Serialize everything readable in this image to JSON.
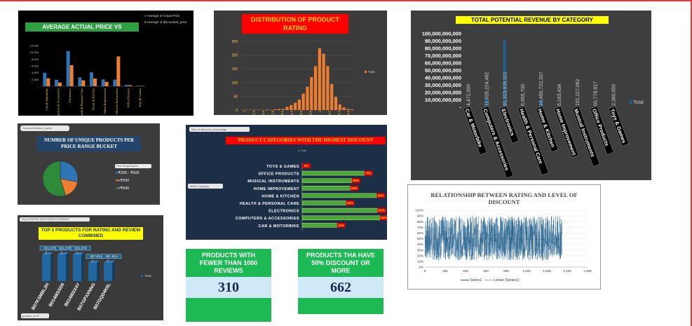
{
  "charts": {
    "avg_price": {
      "title": "AVERAGE ACTUAL PRICE VS",
      "legend": [
        "Average of Actual Price",
        "Average of discounted_price"
      ],
      "colors": {
        "actual": "#2e75b6",
        "discounted": "#ed7d31"
      },
      "yticks": [
        "12,000",
        "10,000",
        "8,000",
        "6,000",
        "4,000",
        "2,000",
        "-"
      ],
      "categories": [
        "Car & Motorbike",
        "Computers & Accessories",
        "Electronics",
        "Health & Personal Care",
        "Home & Kitchen",
        "Home Improvement",
        "Musical Instruments",
        "OfficeProducts",
        "Toys & Games"
      ]
    },
    "rating_dist": {
      "title": "DISTRIBUTION OF PRODUCT RATING",
      "legend": "Total",
      "yticks": [
        "250",
        "200",
        "150",
        "100",
        "50",
        "0"
      ]
    },
    "revenue": {
      "title": "TOTAL POTENTIAL REVENUE BY CATEGORY",
      "legend": "Total",
      "yticks": [
        "100,000,000,000",
        "90,000,000,000",
        "80,000,000,000",
        "70,000,000,000",
        "60,000,000,000",
        "50,000,000,000",
        "40,000,000,000",
        "30,000,000,000",
        "20,000,000,000",
        "10,000,000,000",
        "-"
      ],
      "values": [
        "4,472,000",
        "11,628,224,482",
        "91,323,918,321",
        "6,959,700",
        "10,459,722,337",
        "6,163,434",
        "151,117,062",
        "60,778,817",
        "2,380,050"
      ],
      "categories": [
        "Car & Motorbike",
        "Computers & Accessories",
        "Electronics",
        "Health & Personal Care",
        "Home & Kitchen",
        "Home Improvement",
        "Musical Instruments",
        "Office Products",
        "Toys & Games"
      ]
    },
    "price_bucket": {
      "filter": "Count of product_name",
      "title": "NUMBER OF UNIQUE PRODUCTS PER PRICE RANGE BUCKET",
      "legend_title": "Price Range Bucket",
      "legend": [
        "₹200 - ₹500",
        "<₹200",
        ">₹500"
      ]
    },
    "discount": {
      "filter": "Max of discount_percentage",
      "title": "PRODUCT CATEGORIES WITH THE HIGHEST DISCOUNT",
      "legend": "Total",
      "slicer": "MAIN Category",
      "categories": [
        "TOYS & GAMES",
        "OFFICE PRODUCTS",
        "MUSICAL INSTRUMENTS",
        "HOME IMPROVEMENT",
        "HOME & KITCHEN",
        "HEALTH & PERSONAL CARE",
        "ELECTRONICS",
        "COMPUTERS & ACCESSORIES",
        "CAR & MOTORBIKE"
      ],
      "labels": [
        "0%",
        "75%",
        "60%",
        "58%",
        "90%",
        "53%",
        "91%",
        "94%",
        "42%"
      ]
    },
    "top5": {
      "filter": "Sum of RATING AND REVIEW COMBINED",
      "title": "TOP 5 PRODUCTS FOR RATING AND REVIEW COMBINED",
      "legend": "Total",
      "slicer": "product_id",
      "labels": [
        "531,376",
        "531,376",
        "531,376",
        "367,613",
        "367,613"
      ],
      "categories": [
        "B07KSMBL2H",
        "B014I8SSD0",
        "B014I8SX4Y",
        "B07GPXXNNG",
        "B07GQD4K6L"
      ]
    },
    "scatter": {
      "title": "RELATIONSHIP BETWEEN RATING AND LEVEL OF DISCOUNT",
      "yticks": [
        "100%",
        "90%",
        "80%",
        "70%",
        "60%",
        "50%",
        "40%",
        "30%",
        "20%",
        "10%",
        "0%"
      ],
      "xticks": [
        "0",
        "200",
        "400",
        "600",
        "800",
        "1,000",
        "1,200",
        "1,400",
        "1,600"
      ],
      "legend": [
        "Series1",
        "Linear (Series1)"
      ]
    }
  },
  "chart_data": [
    {
      "type": "bar",
      "categories": [
        "Car & Motorbike",
        "Computers & Accessories",
        "Electronics",
        "Health & Personal Care",
        "Home & Kitchen",
        "Home Improvement",
        "Musical Instruments",
        "OfficeProducts",
        "Toys & Games"
      ],
      "ylim": [
        0,
        12000
      ],
      "series": [
        {
          "name": "Average of Actual Price",
          "values": [
            4000,
            1900,
            10400,
            2600,
            4100,
            2000,
            1950,
            400,
            150
          ]
        },
        {
          "name": "Average of discounted_price",
          "values": [
            2350,
            1100,
            6200,
            1750,
            2300,
            1300,
            8800,
            300,
            110
          ]
        }
      ]
    },
    {
      "type": "bar",
      "categories": [
        "2",
        "2.3",
        "2.6",
        "2.9",
        "3.1",
        "3.4",
        "3.6",
        "3.8",
        "4",
        "4.2",
        "4.4",
        "4.6"
      ],
      "ylim": [
        0,
        250
      ],
      "values": [
        1,
        1,
        1,
        1,
        1,
        1,
        2,
        1,
        3,
        4,
        4,
        12,
        18,
        27,
        38,
        60,
        85,
        120,
        160,
        225,
        205,
        160,
        95,
        48,
        20,
        10,
        4,
        3
      ]
    },
    {
      "type": "bar",
      "categories": [
        "Car & Motorbike",
        "Computers & Accessories",
        "Electronics",
        "Health & Personal Care",
        "Home & Kitchen",
        "Home Improvement",
        "Musical Instruments",
        "Office Products",
        "Toys & Games"
      ],
      "ylim": [
        0,
        100000000000
      ],
      "values": [
        4472000,
        11628224482,
        91323918321,
        6959700,
        10459722337,
        6163434,
        151117062,
        60778817,
        2380050
      ]
    },
    {
      "type": "pie",
      "categories": [
        "₹200 - ₹500",
        "<₹200",
        ">₹500"
      ],
      "values": [
        28,
        17,
        55
      ],
      "colors": [
        "#2e75b6",
        "#ed7d31",
        "#2e8b3a"
      ]
    },
    {
      "type": "bar",
      "categories": [
        "TOYS & GAMES",
        "OFFICE PRODUCTS",
        "MUSICAL INSTRUMENTS",
        "HOME IMPROVEMENT",
        "HOME & KITCHEN",
        "HEALTH & PERSONAL CARE",
        "ELECTRONICS",
        "COMPUTERS & ACCESSORIES",
        "CAR & MOTORBIKE"
      ],
      "values": [
        0,
        75,
        60,
        58,
        90,
        53,
        91,
        94,
        42
      ]
    },
    {
      "type": "bar",
      "categories": [
        "B07KSMBL2H",
        "B014I8SSD0",
        "B014I8SX4Y",
        "B07GPXXNNG",
        "B07GQD4K6L"
      ],
      "values": [
        531376,
        531376,
        531376,
        367613,
        367613
      ]
    },
    {
      "type": "line",
      "xlim": [
        0,
        1600
      ],
      "ylim": [
        0,
        1
      ],
      "n_points": 1350
    }
  ],
  "kpis": [
    {
      "label": "PRODUCTS WITH FEWER THAN 1000 REVIEWS",
      "value": "310"
    },
    {
      "label": "PRODUCTS THA HAVE 50% DISCOUNT OR MORE",
      "value": "662"
    }
  ]
}
